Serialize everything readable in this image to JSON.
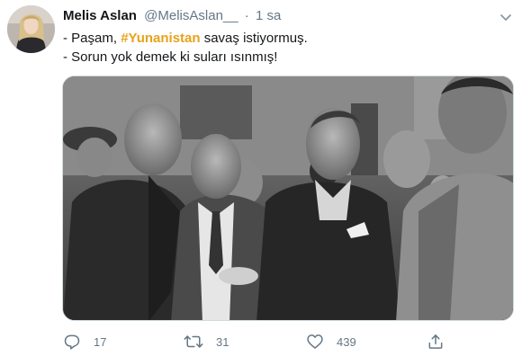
{
  "tweet": {
    "display_name": "Melis Aslan",
    "handle": "@MelisAslan__",
    "separator": "·",
    "time": "1 sa",
    "line1_prefix": "- Paşam, ",
    "hashtag": "#Yunanistan",
    "line1_suffix": " savaş istiyormuş.",
    "line2": "- Sorun yok demek ki suları ısınmış!"
  },
  "actions": {
    "replies": "17",
    "retweets": "31",
    "likes": "439"
  },
  "colors": {
    "hashtag": "#e8a21b",
    "secondary_text": "#657786",
    "primary_text": "#14171a"
  },
  "icons": {
    "reply": "reply-icon",
    "retweet": "retweet-icon",
    "like": "heart-icon",
    "share": "share-icon",
    "menu": "chevron-down-icon"
  }
}
